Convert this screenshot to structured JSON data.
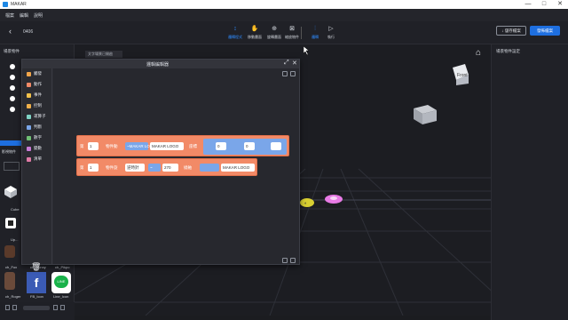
{
  "window": {
    "app_title": "MAKAR",
    "minimize": "—",
    "maximize": "□",
    "close": "✕"
  },
  "menu": [
    "檔案",
    "編輯",
    "說明"
  ],
  "toolbar": {
    "back_icon": "‹",
    "project_name": "0406",
    "tools": [
      {
        "label": "邏輯程式",
        "icon": "↕",
        "active": true
      },
      {
        "label": "移動畫面",
        "icon": "✋",
        "active": false
      },
      {
        "label": "旋轉畫面",
        "icon": "⊕",
        "active": false
      },
      {
        "label": "縮放物件",
        "icon": "⊠",
        "active": false
      },
      {
        "label": "邏輯",
        "icon": "⫶",
        "active": true
      },
      {
        "label": "執行",
        "icon": "▷",
        "active": false
      }
    ],
    "save_label": "↓ 儲存檔案",
    "publish_label": "發佈檔案"
  },
  "left_panel": {
    "title": "場景物件"
  },
  "right_panel": {
    "title": "場景物件設定"
  },
  "viewport": {
    "tab_label": "文字場景已開啟",
    "cube_label": "Front"
  },
  "assets": [
    {
      "label": "Cube",
      "icon": "cube-icon"
    },
    {
      "label": "Up...",
      "icon": "upload-icon"
    },
    {
      "label": "ch_Fox",
      "icon": "character-icon"
    },
    {
      "label": "ch_Bunny",
      "icon": "character-icon"
    },
    {
      "label": "ch_Pikpo",
      "icon": "character-icon"
    },
    {
      "label": "ch_Roger",
      "icon": "character-icon"
    },
    {
      "label": "FB_Icon",
      "icon": "facebook-icon"
    },
    {
      "label": "Line_Icon",
      "icon": "line-icon"
    },
    {
      "label": "影視物件",
      "icon": "folder-icon"
    }
  ],
  "logic_editor": {
    "title": "邏輯編輯器",
    "categories": [
      {
        "label": "觸發",
        "color": "#f2a54a"
      },
      {
        "label": "動作",
        "color": "#f28a67"
      },
      {
        "label": "事件",
        "color": "#f2c14a"
      },
      {
        "label": "控制",
        "color": "#f0b04a"
      },
      {
        "label": "運算子",
        "color": "#7fd3c4"
      },
      {
        "label": "判斷",
        "color": "#7aa6e9"
      },
      {
        "label": "數字",
        "color": "#6fbf73"
      },
      {
        "label": "變數",
        "color": "#c97ad6"
      },
      {
        "label": "清單",
        "color": "#e07aa6"
      }
    ],
    "blocks": [
      {
        "row_label": "第",
        "num": "1",
        "verb": "物件動",
        "field_a": "~MAKAR LOGO",
        "field_b": "MAKAR LOGO",
        "mid": "座標",
        "x": "0",
        "y": "0"
      },
      {
        "row_label": "第",
        "num": "1",
        "verb": "物件旋",
        "mode": "逆時針",
        "deg_prefix": "~",
        "deg": "270",
        "axis": "繞軸",
        "field": "MAKAR LOGO"
      }
    ]
  },
  "colors": {
    "accent": "#1e6fe0",
    "block_orange": "#f28a67",
    "block_blue": "#7aa6e9"
  }
}
